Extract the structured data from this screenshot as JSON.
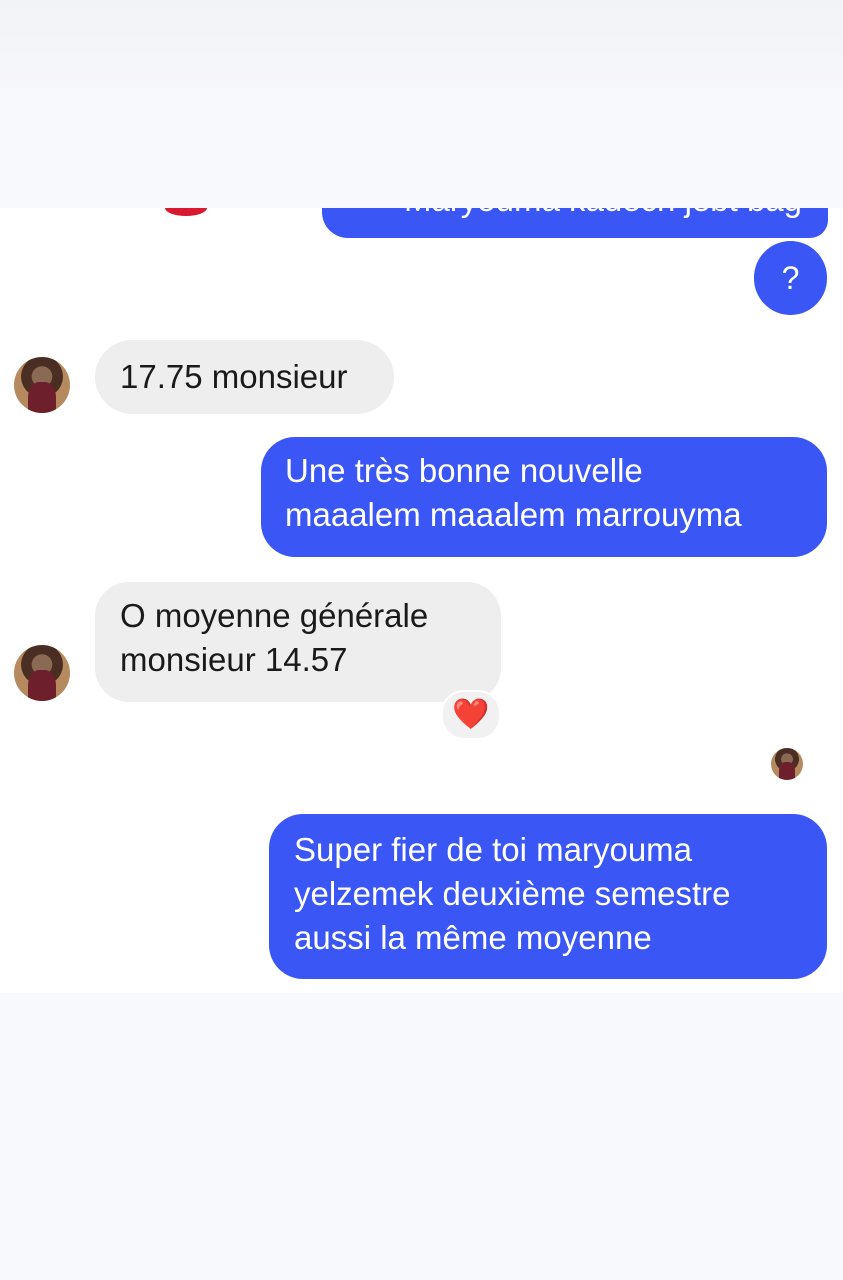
{
  "messages": [
    {
      "direction": "outgoing",
      "text": "Maryouma kadech jebt bag"
    },
    {
      "direction": "outgoing",
      "text": "?"
    },
    {
      "direction": "incoming",
      "text": "17.75 monsieur"
    },
    {
      "direction": "outgoing",
      "lines": [
        "Une très bonne nouvelle",
        "maaalem maaalem marrouyma"
      ]
    },
    {
      "direction": "incoming",
      "lines": [
        "O moyenne générale",
        "monsieur 14.57"
      ],
      "reaction": "❤️"
    },
    {
      "direction": "outgoing",
      "lines": [
        "Super fier de toi maryouma",
        "yelzemek deuxième semestre",
        "aussi la même moyenne"
      ]
    }
  ],
  "colors": {
    "outgoing_bubble": "#3a56f4",
    "incoming_bubble": "#eeeeee",
    "outgoing_text": "#ffffff",
    "incoming_text": "#1a1a1a"
  },
  "icons": {
    "avatar": "contact-avatar",
    "reaction": "heart-icon",
    "read_receipt": "read-receipt-avatar"
  }
}
